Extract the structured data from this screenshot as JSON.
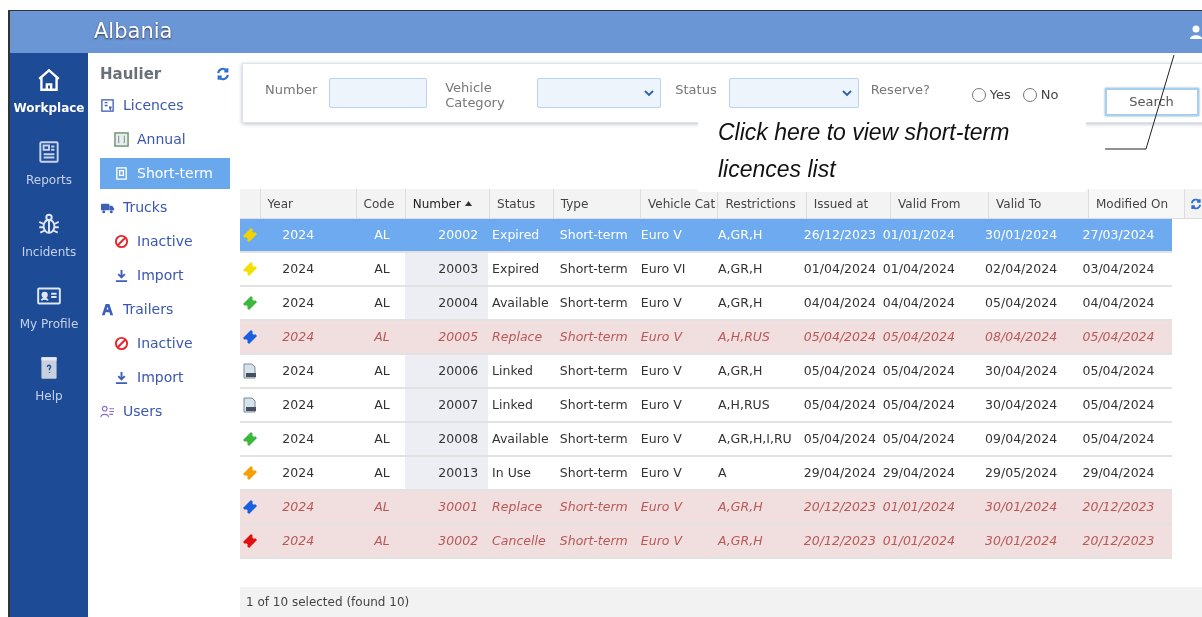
{
  "header": {
    "title": "Albania"
  },
  "nav": [
    {
      "label": "Workplace",
      "selected": true
    },
    {
      "label": "Reports",
      "selected": false
    },
    {
      "label": "Incidents",
      "selected": false
    },
    {
      "label": "My Profile",
      "selected": false
    },
    {
      "label": "Help",
      "selected": false
    }
  ],
  "sidebar": {
    "title": "Haulier",
    "items": [
      {
        "label": "Licences",
        "selected": false,
        "children": [
          {
            "label": "Annual",
            "selected": false
          },
          {
            "label": "Short-term",
            "selected": true
          }
        ]
      },
      {
        "label": "Trucks",
        "selected": false,
        "children": [
          {
            "label": "Inactive",
            "selected": false
          },
          {
            "label": "Import",
            "selected": false
          }
        ]
      },
      {
        "label": "Trailers",
        "selected": false,
        "children": [
          {
            "label": "Inactive",
            "selected": false
          },
          {
            "label": "Import",
            "selected": false
          }
        ]
      },
      {
        "label": "Users",
        "selected": false
      }
    ]
  },
  "filters": {
    "number_label": "Number",
    "vehicle_category_label": "Vehicle Category",
    "status_label": "Status",
    "reserve_label": "Reserve?",
    "reserve_options": [
      {
        "label": "Yes",
        "selected": false
      },
      {
        "label": "No",
        "selected": false
      }
    ],
    "search_button": "Search"
  },
  "callout": {
    "text": "Click here to view short-term licences list"
  },
  "table": {
    "columns": [
      {
        "label": "Year",
        "sorted": false
      },
      {
        "label": "Code",
        "sorted": false
      },
      {
        "label": "Number",
        "sorted": true
      },
      {
        "label": "Status",
        "sorted": false
      },
      {
        "label": "Type",
        "sorted": false
      },
      {
        "label": "Vehicle Cat",
        "sorted": false
      },
      {
        "label": "Restrictions",
        "sorted": false
      },
      {
        "label": "Issued at",
        "sorted": false
      },
      {
        "label": "Valid From",
        "sorted": false
      },
      {
        "label": "Valid To",
        "sorted": false
      },
      {
        "label": "Modified On",
        "sorted": false
      }
    ],
    "rows": [
      {
        "kind": "ticket",
        "color": "#f2d200",
        "selected": true,
        "inactive": false,
        "cells": [
          "2024",
          "AL",
          "20002",
          "Expired",
          "Short-term",
          "Euro V",
          "A,GR,H",
          "26/12/2023",
          "01/01/2024",
          "30/01/2024",
          "27/03/2024"
        ]
      },
      {
        "kind": "ticket",
        "color": "#f2e000",
        "selected": false,
        "inactive": false,
        "cells": [
          "2024",
          "AL",
          "20003",
          "Expired",
          "Short-term",
          "Euro VI",
          "A,GR,H",
          "01/04/2024",
          "01/04/2024",
          "02/04/2024",
          "03/04/2024"
        ]
      },
      {
        "kind": "ticket",
        "color": "#3cb93c",
        "selected": false,
        "inactive": false,
        "cells": [
          "2024",
          "AL",
          "20004",
          "Available",
          "Short-term",
          "Euro V",
          "A,GR,H",
          "04/04/2024",
          "04/04/2024",
          "05/04/2024",
          "04/04/2024"
        ]
      },
      {
        "kind": "ticket",
        "color": "#1a5fe0",
        "selected": false,
        "inactive": true,
        "cells": [
          "2024",
          "AL",
          "20005",
          "Replace",
          "Short-term",
          "Euro V",
          "A,H,RUS",
          "05/04/2024",
          "05/04/2024",
          "08/04/2024",
          "05/04/2024"
        ]
      },
      {
        "kind": "document",
        "selected": false,
        "inactive": false,
        "cells": [
          "2024",
          "AL",
          "20006",
          "Linked",
          "Short-term",
          "Euro V",
          "A,GR,H",
          "05/04/2024",
          "05/04/2024",
          "30/04/2024",
          "05/04/2024"
        ]
      },
      {
        "kind": "document",
        "selected": false,
        "inactive": false,
        "cells": [
          "2024",
          "AL",
          "20007",
          "Linked",
          "Short-term",
          "Euro V",
          "A,H,RUS",
          "05/04/2024",
          "05/04/2024",
          "30/04/2024",
          "05/04/2024"
        ]
      },
      {
        "kind": "ticket",
        "color": "#3cb93c",
        "selected": false,
        "inactive": false,
        "cells": [
          "2024",
          "AL",
          "20008",
          "Available",
          "Short-term",
          "Euro V",
          "A,GR,H,I,RU",
          "05/04/2024",
          "05/04/2024",
          "09/04/2024",
          "05/04/2024"
        ]
      },
      {
        "kind": "ticket",
        "color": "#f5a000",
        "selected": false,
        "inactive": false,
        "cells": [
          "2024",
          "AL",
          "20013",
          "In Use",
          "Short-term",
          "Euro V",
          "A",
          "29/04/2024",
          "29/04/2024",
          "29/05/2024",
          "29/04/2024"
        ]
      },
      {
        "kind": "ticket",
        "color": "#1a5fe0",
        "selected": false,
        "inactive": true,
        "cells": [
          "2024",
          "AL",
          "30001",
          "Replace",
          "Short-term",
          "Euro V",
          "A,GR,H",
          "20/12/2023",
          "01/01/2024",
          "30/01/2024",
          "20/12/2023"
        ]
      },
      {
        "kind": "ticket",
        "color": "#e01010",
        "selected": false,
        "inactive": true,
        "cells": [
          "2024",
          "AL",
          "30002",
          "Cancelle",
          "Short-term",
          "Euro V",
          "A,GR,H",
          "20/12/2023",
          "01/01/2024",
          "30/01/2024",
          "20/12/2023"
        ]
      }
    ]
  },
  "status_bar": "1 of 10 selected (found 10)"
}
